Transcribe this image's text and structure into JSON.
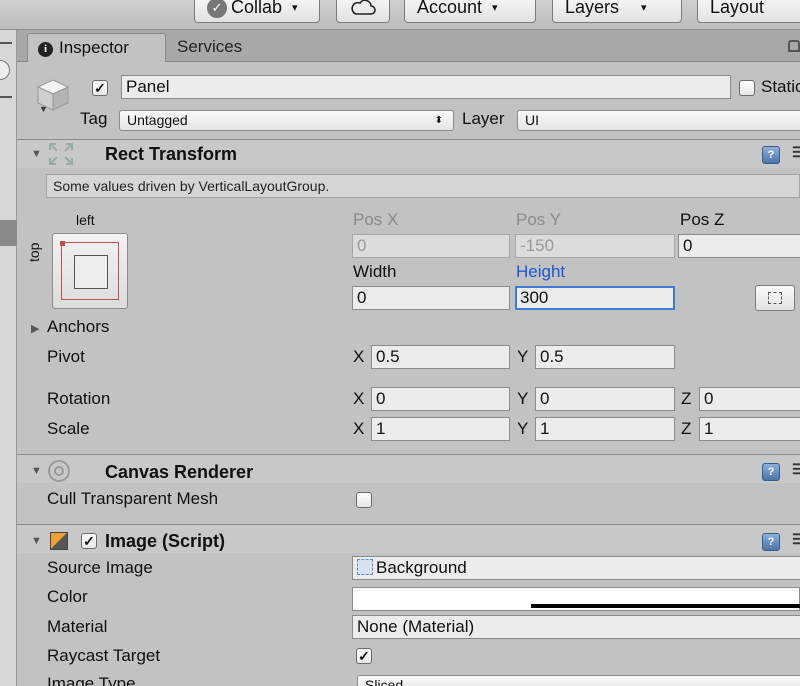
{
  "toolbar": {
    "collab": "Collab",
    "account": "Account",
    "layers": "Layers",
    "layout": "Layout",
    "dropdown_arrow": "▾"
  },
  "tabs": {
    "inspector": "Inspector",
    "services": "Services"
  },
  "header": {
    "name": "Panel",
    "active": true,
    "static_label": "Static",
    "tag_label": "Tag",
    "tag_value": "Untagged",
    "layer_label": "Layer",
    "layer_value": "UI"
  },
  "rect_transform": {
    "title": "Rect Transform",
    "note": "Some values driven by VerticalLayoutGroup.",
    "anchor_h": "left",
    "anchor_v": "top",
    "pos_x_label": "Pos X",
    "pos_y_label": "Pos Y",
    "pos_z_label": "Pos Z",
    "pos_x": "0",
    "pos_y": "-150",
    "pos_z": "0",
    "width_label": "Width",
    "height_label": "Height",
    "width": "0",
    "height": "300",
    "anchors_label": "Anchors",
    "pivot_label": "Pivot",
    "pivot_x": "0.5",
    "pivot_y": "0.5",
    "rotation_label": "Rotation",
    "rot_x": "0",
    "rot_y": "0",
    "rot_z": "0",
    "scale_label": "Scale",
    "scale_x": "1",
    "scale_y": "1",
    "scale_z": "1",
    "axis_x": "X",
    "axis_y": "Y",
    "axis_z": "Z"
  },
  "canvas_renderer": {
    "title": "Canvas Renderer",
    "cull_label": "Cull Transparent Mesh",
    "cull_value": false
  },
  "image_script": {
    "title": "Image (Script)",
    "enabled": true,
    "source_image_label": "Source Image",
    "source_image": "Background",
    "color_label": "Color",
    "color_value": "#ffffff",
    "material_label": "Material",
    "material": "None (Material)",
    "raycast_label": "Raycast Target",
    "raycast_value": true,
    "image_type_label": "Image Type",
    "image_type": "Sliced"
  },
  "colors": {
    "focus": "#3d7bd9",
    "height_label": "#1a56d8",
    "panel_bg": "#c2c2c2"
  }
}
